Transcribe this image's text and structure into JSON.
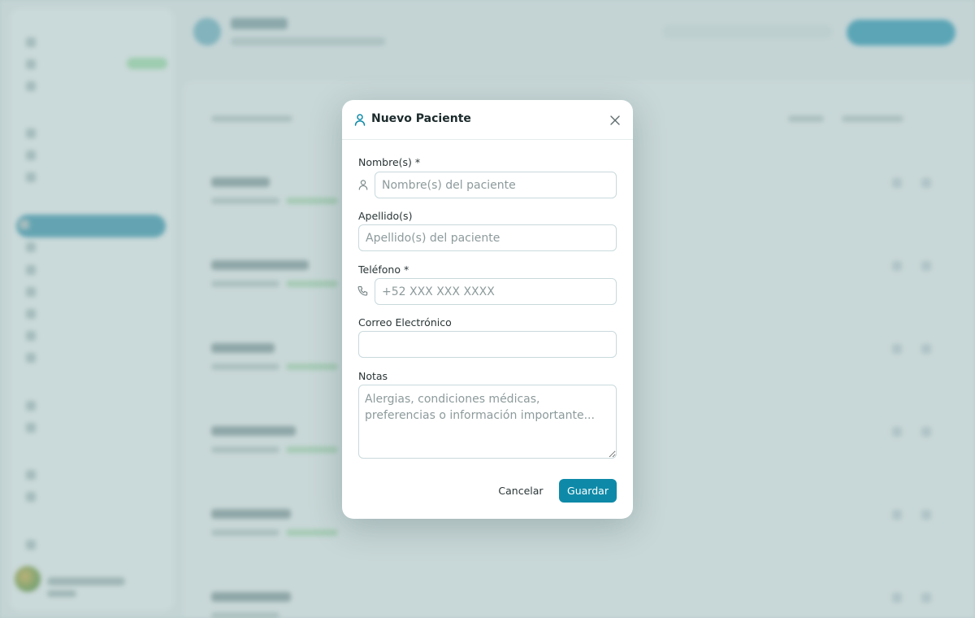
{
  "modal": {
    "title": "Nuevo Paciente",
    "title_icon": "user-icon",
    "close_icon": "close-icon",
    "fields": {
      "first_name": {
        "label": "Nombre(s) *",
        "placeholder": "Nombre(s) del paciente",
        "icon": "user-icon",
        "value": ""
      },
      "last_name": {
        "label": "Apellido(s)",
        "placeholder": "Apellido(s) del paciente",
        "value": ""
      },
      "phone": {
        "label": "Teléfono *",
        "placeholder": "+52 XXX XXX XXXX",
        "icon": "phone-icon",
        "value": ""
      },
      "email": {
        "label": "Correo Electrónico",
        "placeholder": "",
        "value": ""
      },
      "notes": {
        "label": "Notas",
        "placeholder": "Alergias, condiciones médicas, preferencias o información importante...",
        "value": ""
      }
    },
    "actions": {
      "cancel_label": "Cancelar",
      "save_label": "Guardar"
    }
  },
  "colors": {
    "accent": "#0e8aa8",
    "overlay_background": "#c4d3d5",
    "modal_background": "#ffffff",
    "field_border": "#c9d9dc"
  }
}
